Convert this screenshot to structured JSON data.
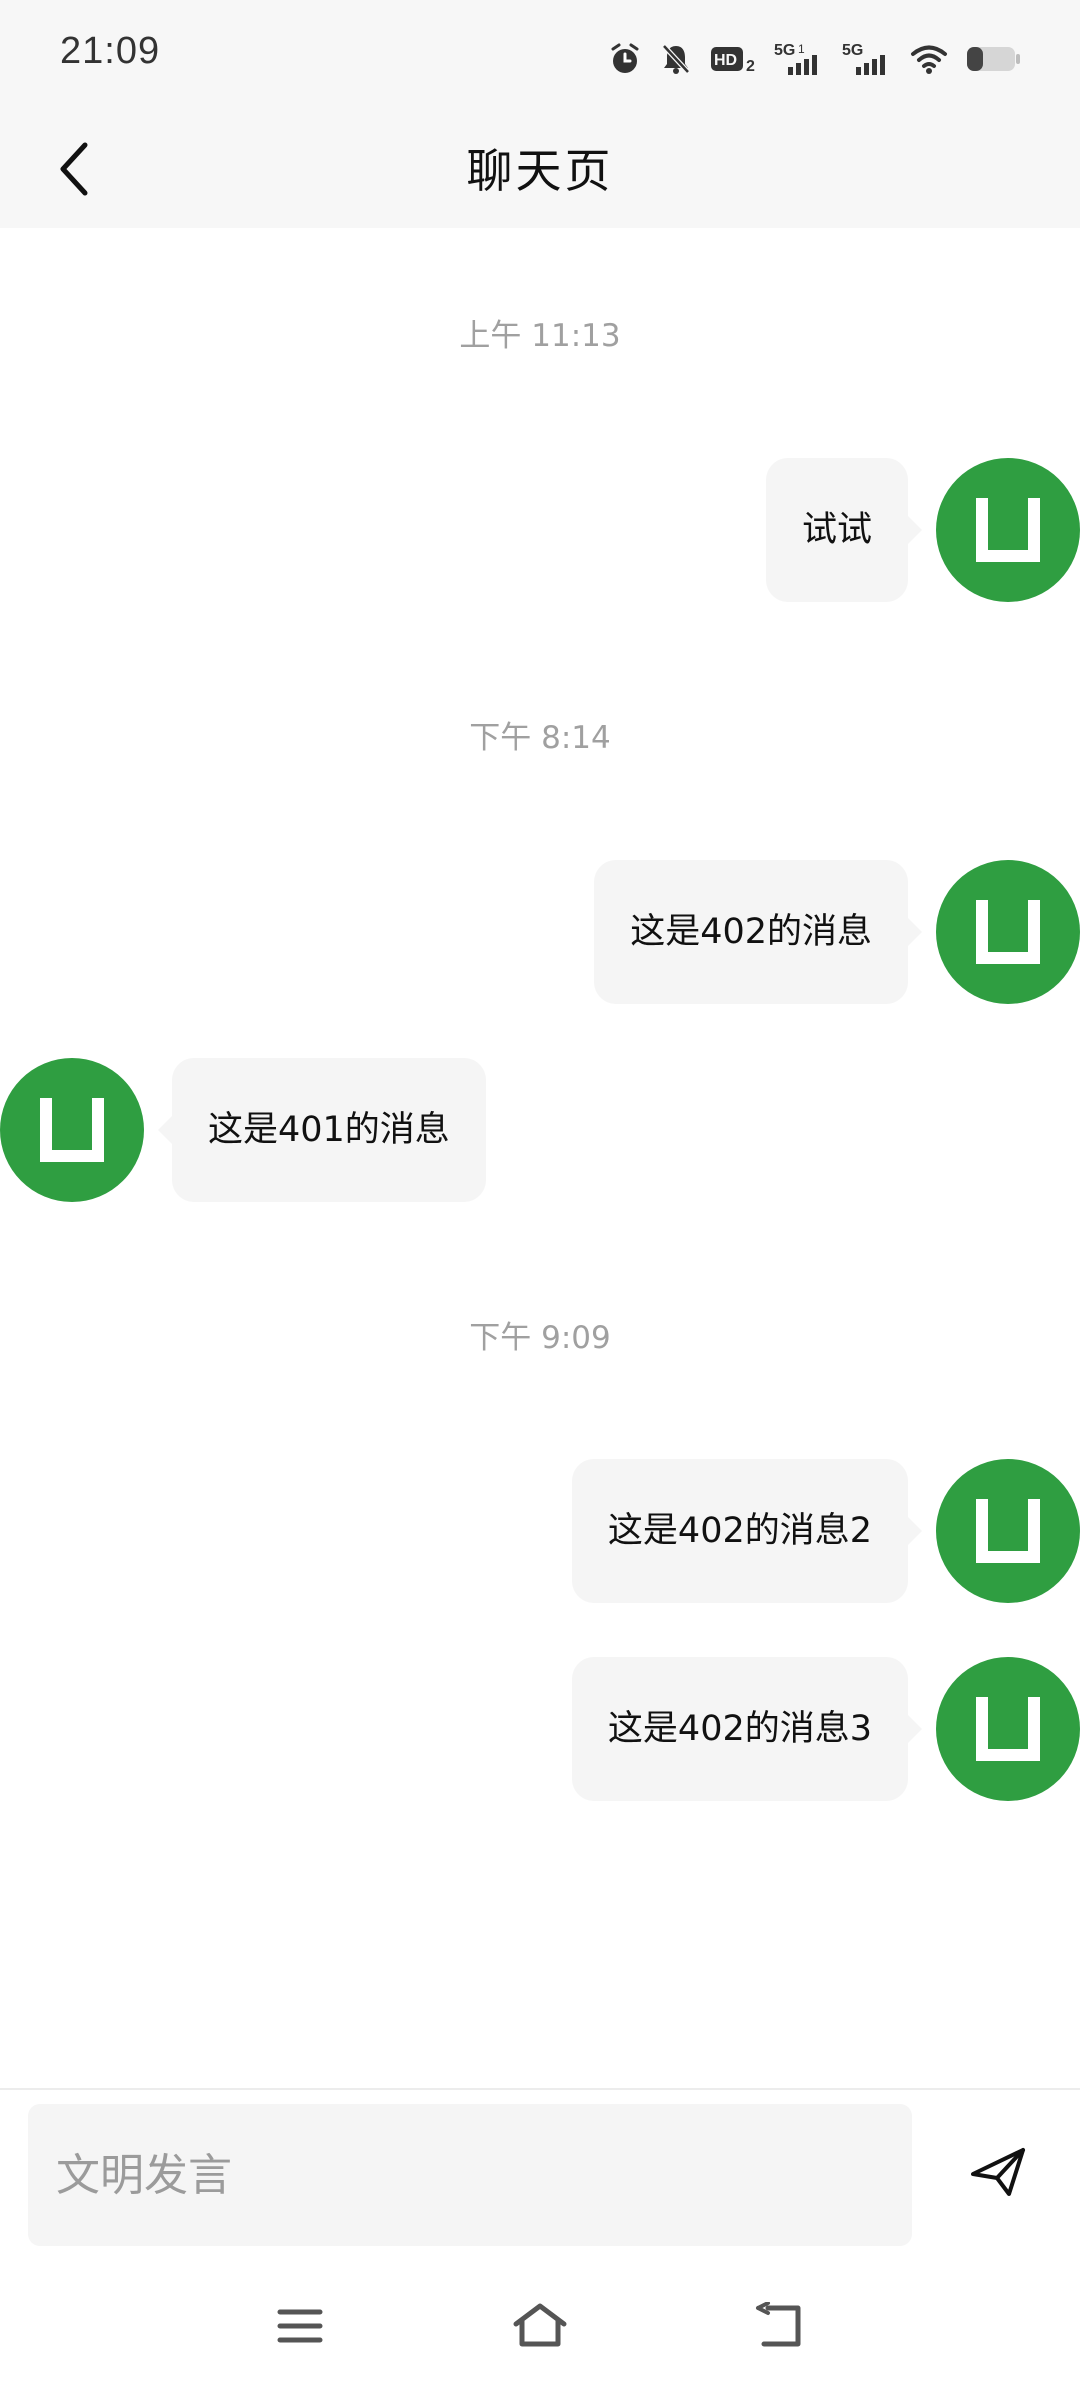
{
  "status_bar": {
    "time": "21:09",
    "icons": [
      "alarm-icon",
      "mute-bell-icon",
      "hd-icon",
      "signal-5g-icon",
      "signal-5g-icon",
      "wifi-icon",
      "battery-icon"
    ],
    "hd_label": "HD",
    "hd_sub": "2",
    "network_1": "5G",
    "network_1_sup": "1",
    "network_2": "5G"
  },
  "header": {
    "title": "聊天页",
    "back_icon": "chevron-left-icon"
  },
  "messages": [
    {
      "type": "time",
      "text": "上午 11:13"
    },
    {
      "type": "message",
      "side": "right",
      "text": "试试"
    },
    {
      "type": "time",
      "text": "下午 8:14"
    },
    {
      "type": "message",
      "side": "right",
      "text": "这是402的消息"
    },
    {
      "type": "message",
      "side": "left",
      "text": "这是401的消息"
    },
    {
      "type": "time",
      "text": "下午 9:09"
    },
    {
      "type": "message",
      "side": "right",
      "text": "这是402的消息2"
    },
    {
      "type": "message",
      "side": "right",
      "text": "这是402的消息3"
    }
  ],
  "input_bar": {
    "placeholder": "文明发言",
    "value": "",
    "send_icon": "send-icon"
  },
  "nav_bar": {
    "icons": [
      "menu-icon",
      "home-icon",
      "back-icon"
    ]
  },
  "colors": {
    "avatar": "#2f9e41",
    "bubble": "#f5f5f5",
    "header_bg": "#f7f7f7",
    "timestamp": "#a0a0a0"
  }
}
